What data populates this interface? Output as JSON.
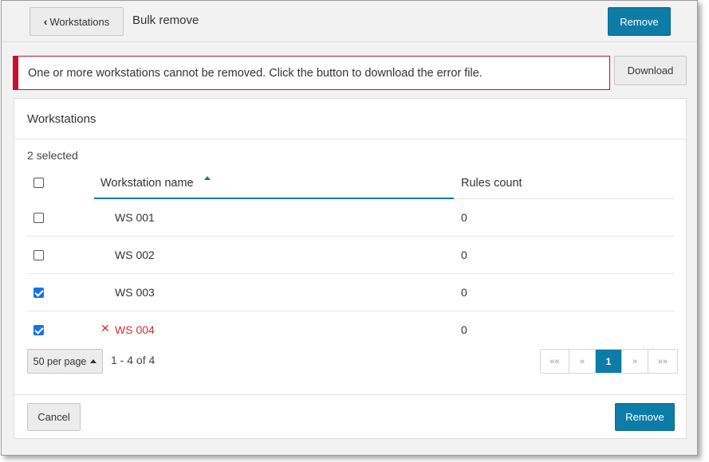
{
  "header": {
    "back_label": "Workstations",
    "title": "Bulk remove",
    "remove_label": "Remove"
  },
  "alert": {
    "message": "One or more workstations cannot be removed. Click the button to download the error file.",
    "download_label": "Download",
    "color": "#c8102e"
  },
  "panel": {
    "title": "Workstations",
    "selected_text": "2 selected",
    "columns": {
      "name": "Workstation name",
      "rules": "Rules count"
    },
    "rows": [
      {
        "name": "WS 001",
        "rules": "0",
        "checked": false,
        "error": false
      },
      {
        "name": "WS 002",
        "rules": "0",
        "checked": false,
        "error": false
      },
      {
        "name": "WS 003",
        "rules": "0",
        "checked": true,
        "error": false
      },
      {
        "name": "WS 004",
        "rules": "0",
        "checked": true,
        "error": true
      }
    ],
    "per_page_label": "50 per page",
    "range_text": "1 - 4 of 4",
    "pager": {
      "first": "««",
      "prev": "«",
      "current": "1",
      "next": "»",
      "last": "»»"
    },
    "cancel_label": "Cancel",
    "remove_label": "Remove"
  },
  "colors": {
    "accent": "#0d7ca6",
    "error": "#d0312d",
    "checkbox_checked": "#1a73e8"
  }
}
